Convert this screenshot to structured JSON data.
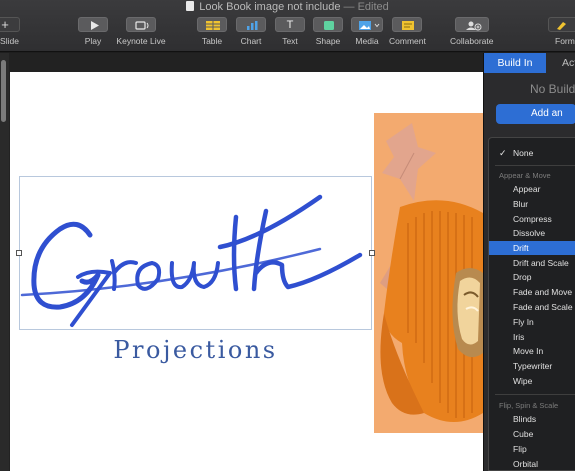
{
  "window": {
    "title": "Look Book image not include",
    "edited": "— Edited"
  },
  "toolbar": {
    "add_slide": "ld Slide",
    "play": "Play",
    "keynote_live": "Keynote Live",
    "table": "Table",
    "chart": "Chart",
    "text": "Text",
    "shape": "Shape",
    "media": "Media",
    "comment": "Comment",
    "collaborate": "Collaborate",
    "format": "Form"
  },
  "slide": {
    "headline": "Growth",
    "subtitle": "Projections",
    "headline_color": "#2f4fd0"
  },
  "panel": {
    "tab_build_in": "Build In",
    "tab_action": "Acti",
    "no_build": "No Build",
    "add_button": "Add an"
  },
  "menu": {
    "selected": "Drift",
    "none_label": "None",
    "section_appear": "Appear & Move",
    "appear_items": [
      "Appear",
      "Blur",
      "Compress",
      "Dissolve",
      "Drift",
      "Drift and Scale",
      "Drop",
      "Fade and Move",
      "Fade and Scale",
      "Fly In",
      "Iris",
      "Move In",
      "Typewriter",
      "Wipe"
    ],
    "section_flip": "Flip, Spin & Scale",
    "flip_items": [
      "Blinds",
      "Cube",
      "Flip",
      "Orbital"
    ]
  },
  "colors": {
    "accent": "#2d6ed4",
    "toolbar_bg": "#343436",
    "sweater": "#e8811e"
  }
}
